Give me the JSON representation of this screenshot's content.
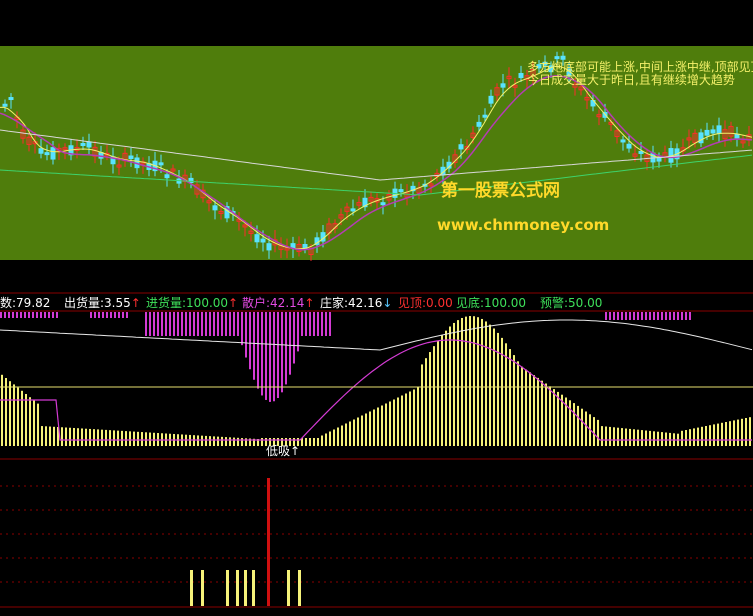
{
  "colors": {
    "top_panel_bg": "#4f7d0c",
    "candle_up": "#ff2b2b",
    "candle_down": "#58e3ff",
    "ma_white": "#d8d8d8",
    "ma_yellow": "#f4f06a",
    "ma_green": "#3ed36b",
    "ma_magenta": "#b43cb4",
    "grid_red": "#8a0000",
    "yellow_bars": "#f6f27a",
    "magenta_bars": "#d43bd4"
  },
  "top_panel": {
    "signal_text_line1": "多方炮底部可能上涨,中间上涨中继,顶部见顶",
    "signal_text_line2": "今日成交量大于昨日,且有继续增大趋势",
    "watermark_title": "第一股票公式网",
    "watermark_url": "www.chnmoney.com"
  },
  "indicator_header": {
    "items": [
      {
        "label": "数:",
        "value": "79.82",
        "arrow": "",
        "label_color": "#ffffff",
        "value_color": "#ffffff",
        "arrow_color": ""
      },
      {
        "label": "出货量:",
        "value": "3.55",
        "arrow": "↑",
        "label_color": "#ffffff",
        "value_color": "#ffffff",
        "arrow_color": "#ff3030"
      },
      {
        "label": "进货量:",
        "value": "100.00",
        "arrow": "↑",
        "label_color": "#3ee05a",
        "value_color": "#3ee05a",
        "arrow_color": "#ff3030"
      },
      {
        "label": "散户:",
        "value": "42.14",
        "arrow": "↑",
        "label_color": "#e24be2",
        "value_color": "#e24be2",
        "arrow_color": "#ff3030"
      },
      {
        "label": "庄家:",
        "value": "42.16",
        "arrow": "↓",
        "label_color": "#ffffff",
        "value_color": "#ffffff",
        "arrow_color": "#58c8ff"
      },
      {
        "label": "见顶:",
        "value": "0.00",
        "arrow": "",
        "label_color": "#ff3030",
        "value_color": "#ff3030",
        "arrow_color": ""
      },
      {
        "label": "见底:",
        "value": "100.00",
        "arrow": "",
        "label_color": "#3ee05a",
        "value_color": "#3ee05a",
        "arrow_color": ""
      },
      {
        "label": "预警:",
        "value": "50.00",
        "arrow": "",
        "label_color": "#3ee05a",
        "value_color": "#3ee05a",
        "arrow_color": ""
      }
    ]
  },
  "middle_panel": {
    "low_buy_label": "低吸↑"
  },
  "chart_data": {
    "type": "bar",
    "candles_count": 125,
    "mid_volume_series": [
      {
        "name": "进货量",
        "color": "#f6f27a"
      },
      {
        "name": "散户",
        "color": "#d43bd4"
      }
    ]
  }
}
